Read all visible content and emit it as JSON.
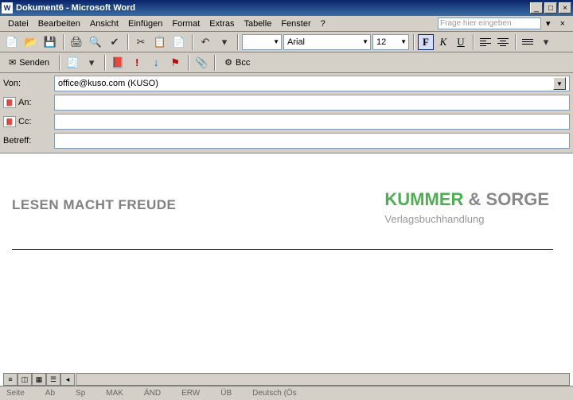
{
  "title": "Dokument6 - Microsoft Word",
  "menu": {
    "datei": "Datei",
    "bearbeiten": "Bearbeiten",
    "ansicht": "Ansicht",
    "einfuegen": "Einfügen",
    "format": "Format",
    "extras": "Extras",
    "tabelle": "Tabelle",
    "fenster": "Fenster",
    "hilfe": "?",
    "ask_placeholder": "Frage hier eingeben"
  },
  "format_toolbar": {
    "font": "Arial",
    "size": "12",
    "bold": "F",
    "italic": "K",
    "underline": "U"
  },
  "mail_toolbar": {
    "send": "Senden",
    "bcc": "Bcc"
  },
  "mail": {
    "von_label": "Von:",
    "von_value": "office@kuso.com   (KUSO)",
    "an_label": "An:",
    "an_value": "",
    "cc_label": "Cc:",
    "cc_value": "",
    "betreff_label": "Betreff:",
    "betreff_value": ""
  },
  "document": {
    "slogan": "LESEN MACHT FREUDE",
    "company_green": "KUMMER",
    "company_amp": " & ",
    "company_gray": "SORGE",
    "company_sub": "Verlagsbuchhandlung"
  },
  "status": {
    "seite": "Seite",
    "ab": "Ab",
    "sp": "Sp",
    "mak": "MAK",
    "and": "ÄND",
    "erw": "ERW",
    "ub": "ÜB",
    "lang": "Deutsch (Ös"
  }
}
